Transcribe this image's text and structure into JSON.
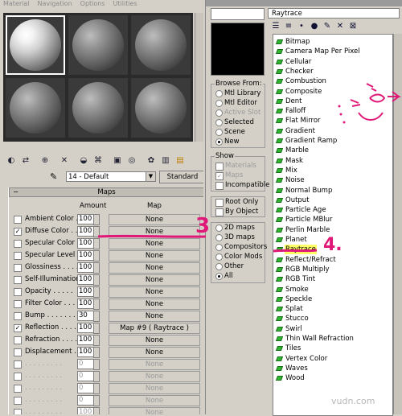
{
  "menu": [
    "Material",
    "Navigation",
    "Options",
    "Utilities"
  ],
  "toolbar_icons": [
    "get-material-icon",
    "put-to-scene-icon",
    "assign-icon",
    "reset-icon",
    "make-copy-icon",
    "unique-icon",
    "put-library-icon",
    "material-id-icon",
    "show-map-icon",
    "show-end-result-icon",
    "go-parent-icon"
  ],
  "material": {
    "picker_icon": "eyedropper-icon",
    "name": "14 - Default",
    "type_button": "Standard"
  },
  "maps_panel": {
    "collapse": "−",
    "title": "Maps",
    "col_amount": "Amount",
    "col_map": "Map",
    "rows": [
      {
        "label": "Ambient Color . .",
        "amount": "100",
        "map": "None",
        "checked": false,
        "enabled": true
      },
      {
        "label": "Diffuse Color . . .",
        "amount": "100",
        "map": "None",
        "checked": true,
        "enabled": true
      },
      {
        "label": "Specular Color . .",
        "amount": "100",
        "map": "None",
        "checked": false,
        "enabled": true
      },
      {
        "label": "Specular Level . .",
        "amount": "100",
        "map": "None",
        "checked": false,
        "enabled": true
      },
      {
        "label": "Glossiness . . . .",
        "amount": "100",
        "map": "None",
        "checked": false,
        "enabled": true
      },
      {
        "label": "Self-Illumination .",
        "amount": "100",
        "map": "None",
        "checked": false,
        "enabled": true
      },
      {
        "label": "Opacity . . . . .",
        "amount": "100",
        "map": "None",
        "checked": false,
        "enabled": true
      },
      {
        "label": "Filter Color . . .",
        "amount": "100",
        "map": "None",
        "checked": false,
        "enabled": true
      },
      {
        "label": "Bump . . . . . . .",
        "amount": "30",
        "map": "None",
        "checked": false,
        "enabled": true
      },
      {
        "label": "Reflection . . . .",
        "amount": "100",
        "map": "Map #9 ( Raytrace )",
        "checked": true,
        "enabled": true
      },
      {
        "label": "Refraction . . . .",
        "amount": "100",
        "map": "None",
        "checked": false,
        "enabled": true
      },
      {
        "label": "Displacement . . .",
        "amount": "100",
        "map": "None",
        "checked": false,
        "enabled": true
      },
      {
        "label": ". . . . . . . . .",
        "amount": "0",
        "map": "None",
        "checked": false,
        "enabled": false
      },
      {
        "label": ". . . . . . . . .",
        "amount": "0",
        "map": "None",
        "checked": false,
        "enabled": false
      },
      {
        "label": ". . . . . . . . .",
        "amount": "0",
        "map": "None",
        "checked": false,
        "enabled": false
      },
      {
        "label": ". . . . . . . . .",
        "amount": "0",
        "map": "None",
        "checked": false,
        "enabled": false
      },
      {
        "label": ". . . . . . . . .",
        "amount": "100",
        "map": "None",
        "checked": false,
        "enabled": false
      }
    ]
  },
  "browser": {
    "title_text": "Raytrace",
    "browse_from": {
      "title": "Browse From:",
      "options": [
        {
          "label": "Mtl Library",
          "selected": false,
          "enabled": true
        },
        {
          "label": "Mtl Editor",
          "selected": false,
          "enabled": true
        },
        {
          "label": "Active Slot",
          "selected": false,
          "enabled": false
        },
        {
          "label": "Selected",
          "selected": false,
          "enabled": true
        },
        {
          "label": "Scene",
          "selected": false,
          "enabled": true
        },
        {
          "label": "New",
          "selected": true,
          "enabled": true
        }
      ]
    },
    "show": {
      "title": "Show",
      "options": [
        {
          "label": "Materials",
          "checked": false,
          "enabled": false
        },
        {
          "label": "Maps",
          "checked": true,
          "enabled": false
        },
        {
          "label": "Incompatible",
          "checked": false,
          "enabled": true
        }
      ]
    },
    "root": {
      "options": [
        {
          "label": "Root Only",
          "checked": false
        },
        {
          "label": "By Object",
          "checked": false
        }
      ]
    },
    "map_filter": {
      "options": [
        {
          "label": "2D maps",
          "selected": false
        },
        {
          "label": "3D maps",
          "selected": false
        },
        {
          "label": "Compositors",
          "selected": false
        },
        {
          "label": "Color Mods",
          "selected": false
        },
        {
          "label": "Other",
          "selected": false
        },
        {
          "label": "All",
          "selected": true
        }
      ]
    },
    "maps": [
      "Bitmap",
      "Camera Map Per Pixel",
      "Cellular",
      "Checker",
      "Combustion",
      "Composite",
      "Dent",
      "Falloff",
      "Flat Mirror",
      "Gradient",
      "Gradient Ramp",
      "Marble",
      "Mask",
      "Mix",
      "Noise",
      "Normal Bump",
      "Output",
      "Particle Age",
      "Particle MBlur",
      "Perlin Marble",
      "Planet",
      "Raytrace",
      "Reflect/Refract",
      "RGB Multiply",
      "RGB Tint",
      "Smoke",
      "Speckle",
      "Splat",
      "Stucco",
      "Swirl",
      "Thin Wall Refraction",
      "Tiles",
      "Vertex Color",
      "Waves",
      "Wood"
    ],
    "selected_map": "Raytrace"
  },
  "annotations": {
    "three": "3",
    "four": "4."
  },
  "watermark": "vudn.com",
  "colors": {
    "annotation": "#e01878",
    "highlight": "#ffff66",
    "map_gem": "#2fb52f"
  }
}
